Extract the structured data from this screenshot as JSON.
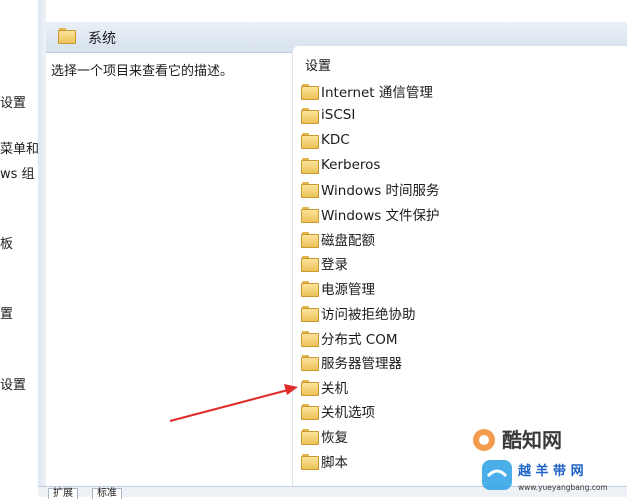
{
  "left_tree": {
    "items": [
      "设置",
      "菜单和",
      "ws 组",
      "板",
      "置",
      "设置"
    ]
  },
  "header": {
    "title": "系统"
  },
  "description": {
    "text": "选择一个项目来查看它的描述。"
  },
  "list": {
    "column_header": "设置",
    "items": [
      "Internet 通信管理",
      "iSCSI",
      "KDC",
      "Kerberos",
      "Windows 时间服务",
      "Windows 文件保护",
      "磁盘配额",
      "登录",
      "电源管理",
      "访问被拒绝协助",
      "分布式 COM",
      "服务器管理器",
      "关机",
      "关机选项",
      "恢复",
      "脚本"
    ]
  },
  "bottom_tabs": [
    "扩展",
    "标准"
  ],
  "watermark": {
    "brand": "酷知网",
    "sub": "越 羊 带 网",
    "url": "www.yueyangbang.com"
  },
  "colors": {
    "arrow": "#e02b2b",
    "folder": "#f2c75c",
    "header_bg": "#dde6f0"
  }
}
